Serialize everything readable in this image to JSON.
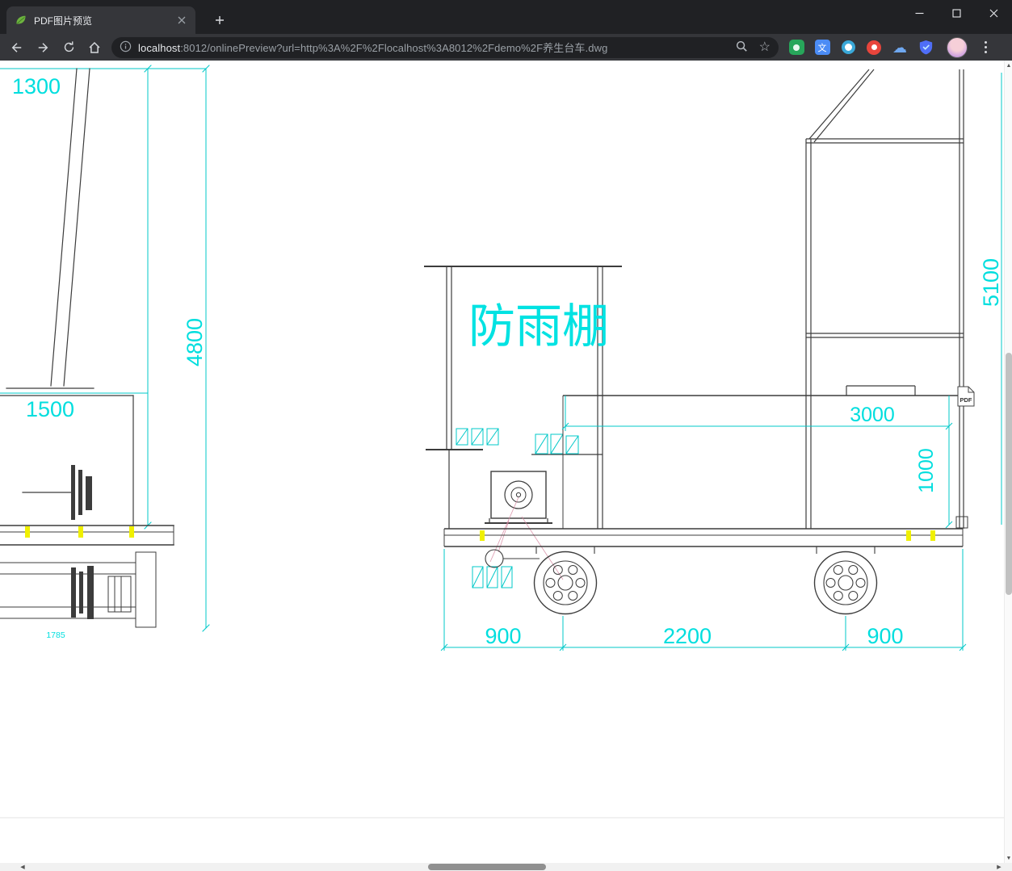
{
  "browser": {
    "tab_title": "PDF图片预览",
    "url_host": "localhost",
    "url_rest": ":8012/onlinePreview?url=http%3A%2F%2Flocalhost%3A8012%2Fdemo%2F养生台车.dwg"
  },
  "icons": {
    "star": "☆",
    "cloud": "☁",
    "translate": "文",
    "up_arrow": "▲",
    "down_arrow": "▼",
    "left_arrow": "◀",
    "right_arrow": "▶"
  },
  "drawing": {
    "shelter_label": "防雨棚",
    "pdf_badge": "PDF",
    "colors": {
      "dimension_cyan": "#00c8c8",
      "line_dark": "#3c3c3c",
      "highlight_yellow": "#f0f000"
    },
    "dims": {
      "left_top_width": "1300",
      "left_height": "4800",
      "pedestal_width": "1500",
      "axle_span": "1785",
      "right_height": "5100",
      "deck_length": "3000",
      "deck_height": "1000",
      "front_overhang": "900",
      "wheelbase": "2200",
      "rear_overhang": "900"
    }
  }
}
